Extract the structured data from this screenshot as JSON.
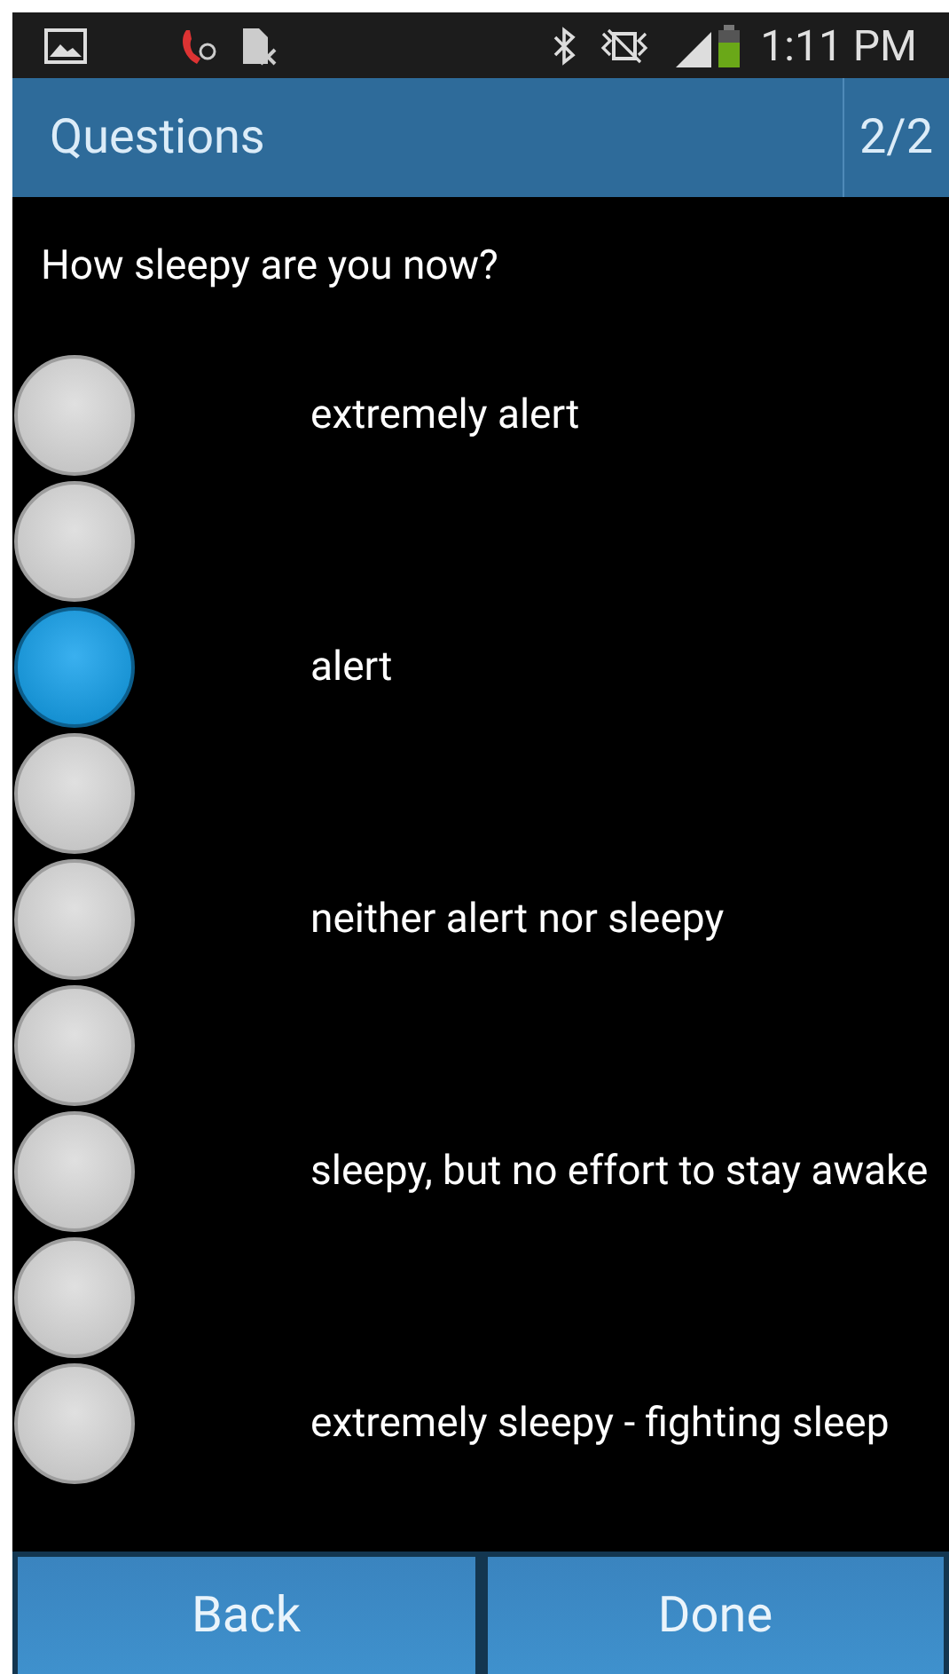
{
  "status_bar": {
    "time": "1:11 PM"
  },
  "header": {
    "title": "Questions",
    "counter": "2/2"
  },
  "question": "How sleepy are you now?",
  "options": [
    {
      "label": "extremely alert",
      "selected": false
    },
    {
      "selected": false
    },
    {
      "label": "alert",
      "selected": true
    },
    {
      "selected": false
    },
    {
      "label": "neither alert nor sleepy",
      "selected": false
    },
    {
      "selected": false
    },
    {
      "label": "sleepy, but no effort to stay awake",
      "selected": false
    },
    {
      "selected": false
    },
    {
      "label": "extremely sleepy - fighting sleep",
      "selected": false
    }
  ],
  "buttons": [
    "Back",
    "Done"
  ]
}
